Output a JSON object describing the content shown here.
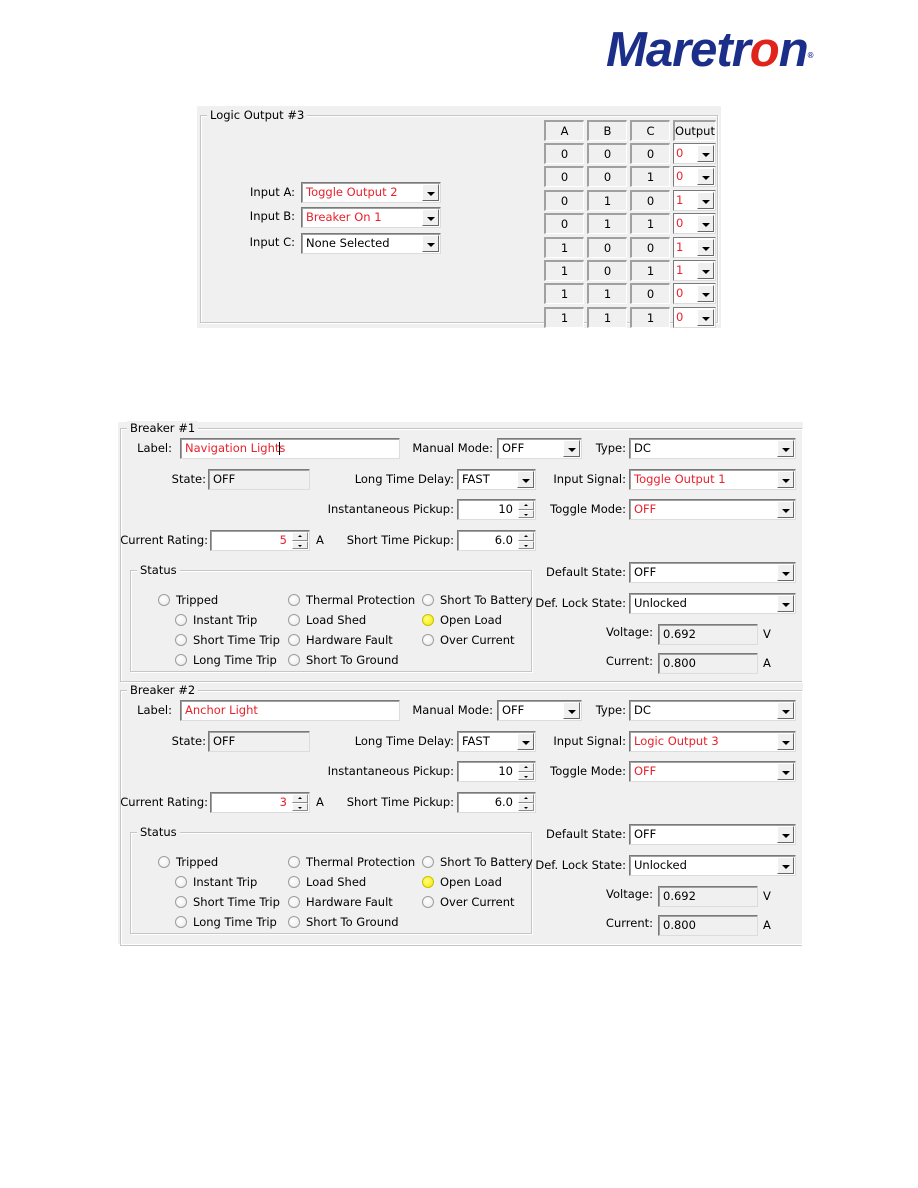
{
  "brand": {
    "name_part1": "Maretr",
    "name_part2": "o",
    "name_part3": "n",
    "registered": "®",
    "primary_color": "#1b2f8a",
    "accent_color": "#e0241b"
  },
  "logic_output": {
    "title": "Logic Output #3",
    "inputs": [
      {
        "label": "Input A:",
        "value": "Toggle Output 2",
        "highlight": true
      },
      {
        "label": "Input B:",
        "value": "Breaker On 1",
        "highlight": true
      },
      {
        "label": "Input C:",
        "value": "None Selected",
        "highlight": false
      }
    ],
    "truth_table": {
      "headers": [
        "A",
        "B",
        "C",
        "Output"
      ],
      "rows": [
        {
          "a": "0",
          "b": "0",
          "c": "0",
          "out": "0"
        },
        {
          "a": "0",
          "b": "0",
          "c": "1",
          "out": "0"
        },
        {
          "a": "0",
          "b": "1",
          "c": "0",
          "out": "1"
        },
        {
          "a": "0",
          "b": "1",
          "c": "1",
          "out": "0"
        },
        {
          "a": "1",
          "b": "0",
          "c": "0",
          "out": "1"
        },
        {
          "a": "1",
          "b": "0",
          "c": "1",
          "out": "1"
        },
        {
          "a": "1",
          "b": "1",
          "c": "0",
          "out": "0"
        },
        {
          "a": "1",
          "b": "1",
          "c": "1",
          "out": "0"
        }
      ]
    }
  },
  "labels": {
    "label": "Label:",
    "manual_mode": "Manual Mode:",
    "type": "Type:",
    "state": "State:",
    "long_time_delay": "Long Time Delay:",
    "input_signal": "Input Signal:",
    "instantaneous_pickup": "Instantaneous Pickup:",
    "toggle_mode": "Toggle Mode:",
    "current_rating": "Current Rating:",
    "short_time_pickup": "Short Time Pickup:",
    "amp_unit": "A",
    "volt_unit": "V",
    "status": "Status",
    "default_state": "Default State:",
    "def_lock_state": "Def. Lock State:",
    "voltage": "Voltage:",
    "current": "Current:"
  },
  "status_items": {
    "tripped": "Tripped",
    "instant_trip": "Instant Trip",
    "short_time_trip": "Short Time Trip",
    "long_time_trip": "Long Time Trip",
    "thermal_protection": "Thermal Protection",
    "load_shed": "Load Shed",
    "hardware_fault": "Hardware Fault",
    "short_to_ground": "Short To Ground",
    "short_to_battery": "Short To Battery",
    "open_load": "Open Load",
    "over_current": "Over Current"
  },
  "breakers": [
    {
      "title": "Breaker #1",
      "label_value": "Navigation Lights",
      "manual_mode": "OFF",
      "type": "DC",
      "state": "OFF",
      "long_time_delay": "FAST",
      "input_signal": "Toggle Output 1",
      "instantaneous_pickup": "10",
      "toggle_mode": "OFF",
      "current_rating": "5",
      "short_time_pickup": "6.0",
      "default_state": "OFF",
      "def_lock_state": "Unlocked",
      "voltage": "0.692",
      "current": "0.800",
      "active_status": [
        "open_load"
      ]
    },
    {
      "title": "Breaker #2",
      "label_value": "Anchor Light",
      "manual_mode": "OFF",
      "type": "DC",
      "state": "OFF",
      "long_time_delay": "FAST",
      "input_signal": "Logic Output 3",
      "instantaneous_pickup": "10",
      "toggle_mode": "OFF",
      "current_rating": "3",
      "short_time_pickup": "6.0",
      "default_state": "OFF",
      "def_lock_state": "Unlocked",
      "voltage": "0.692",
      "current": "0.800",
      "active_status": [
        "open_load"
      ]
    }
  ],
  "colors": {
    "highlight_text": "#e8212b",
    "indicator_on": "#f5e600",
    "panel_bg": "#f0f0f0"
  }
}
